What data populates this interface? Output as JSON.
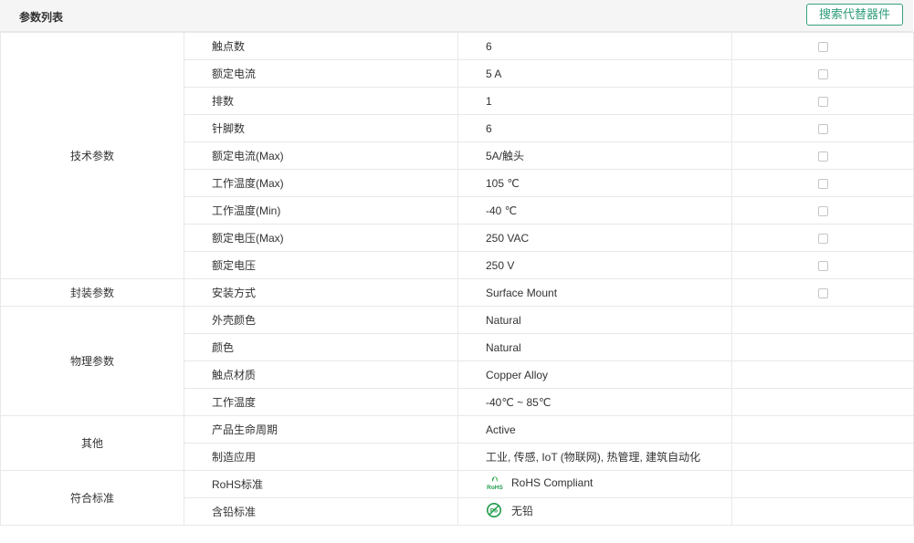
{
  "header": {
    "title": "参数列表",
    "alt_button": "搜索代替器件"
  },
  "categories": {
    "tech": "技术参数",
    "package": "封装参数",
    "physical": "物理参数",
    "other": "其他",
    "compliance": "符合标准"
  },
  "rows": [
    {
      "name": "触点数",
      "value": "6"
    },
    {
      "name": "额定电流",
      "value": "5 A"
    },
    {
      "name": "排数",
      "value": "1"
    },
    {
      "name": "针脚数",
      "value": "6"
    },
    {
      "name": "额定电流(Max)",
      "value": "5A/触头"
    },
    {
      "name": "工作温度(Max)",
      "value": "105 ℃"
    },
    {
      "name": "工作温度(Min)",
      "value": "-40 ℃"
    },
    {
      "name": "额定电压(Max)",
      "value": "250 VAC"
    },
    {
      "name": "额定电压",
      "value": "250 V"
    },
    {
      "name": "安装方式",
      "value": "Surface Mount"
    },
    {
      "name": "外壳颜色",
      "value": "Natural"
    },
    {
      "name": "颜色",
      "value": "Natural"
    },
    {
      "name": "触点材质",
      "value": "Copper Alloy"
    },
    {
      "name": "工作温度",
      "value": "-40℃ ~ 85℃"
    },
    {
      "name": "产品生命周期",
      "value": "Active"
    },
    {
      "name": "制造应用",
      "value": "工业, 传感, IoT (物联网), 热管理, 建筑自动化"
    },
    {
      "name": "RoHS标准",
      "value": "RoHS Compliant",
      "icon": "rohs-leaf-icon",
      "icon_text": "RoHS"
    },
    {
      "name": "含铅标准",
      "value": "无铅",
      "icon": "lead-free-icon",
      "icon_text": "Pb"
    }
  ],
  "colors": {
    "accent": "#2e9c7a",
    "border": "#e8e8e8",
    "header_bg": "#f5f5f5",
    "icon_green": "#1e9b4a"
  }
}
